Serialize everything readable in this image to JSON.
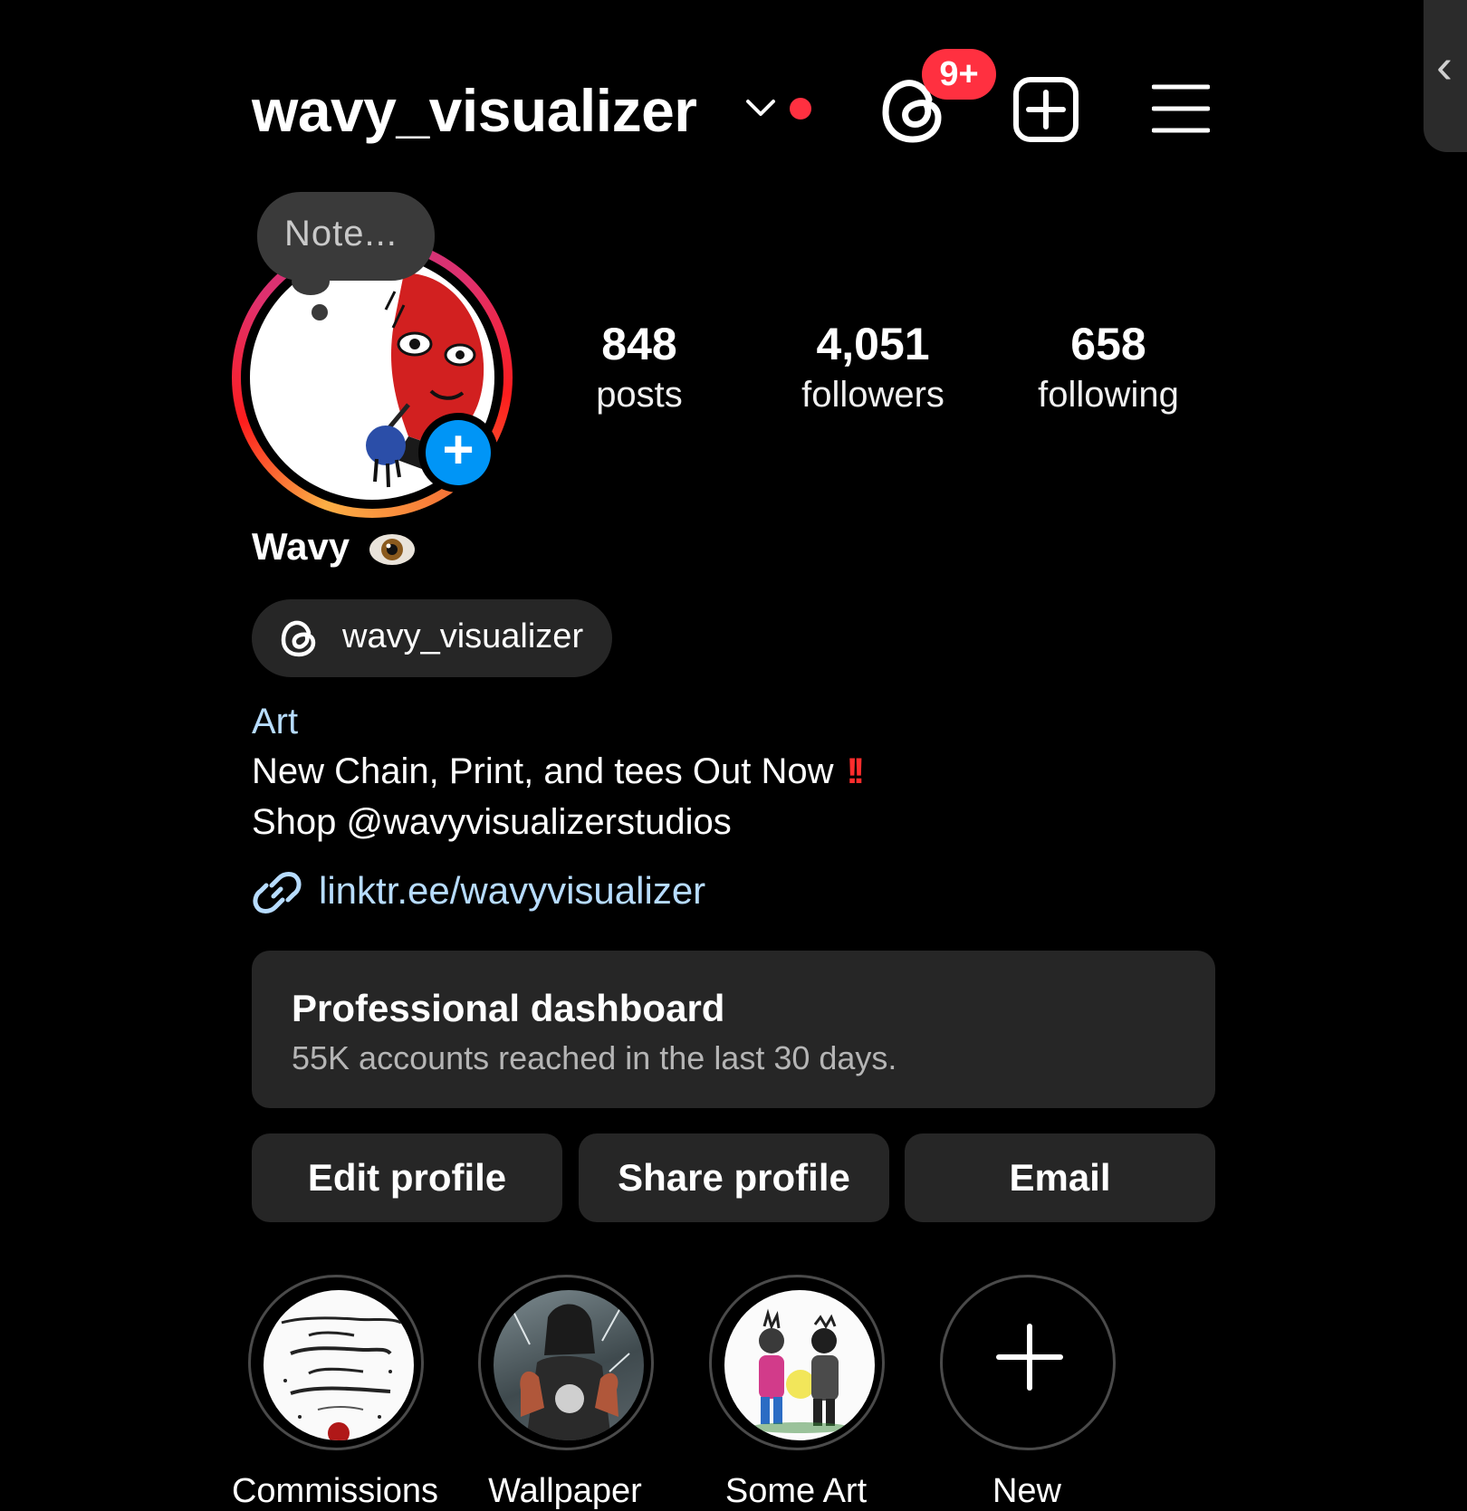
{
  "header": {
    "username": "wavy_visualizer",
    "notification_badge": "9+",
    "accent_color": "#ff3040"
  },
  "note": {
    "placeholder": "Note..."
  },
  "stats": [
    {
      "value": "848",
      "label": "posts"
    },
    {
      "value": "4,051",
      "label": "followers"
    },
    {
      "value": "658",
      "label": "following"
    }
  ],
  "profile": {
    "display_name": "Wavy",
    "threads_handle": "wavy_visualizer",
    "category": "Art",
    "bio_line1": "New Chain, Print, and tees Out Now",
    "bio_line1_emoji": "!!",
    "bio_line2": "Shop @wavyvisualizerstudios",
    "link": "linktr.ee/wavyvisualizer"
  },
  "dashboard": {
    "title": "Professional dashboard",
    "subtitle": "55K accounts reached in the last 30 days."
  },
  "buttons": {
    "edit": "Edit profile",
    "share": "Share profile",
    "email": "Email"
  },
  "highlights": [
    {
      "label": "Commissions"
    },
    {
      "label": "Wallpaper"
    },
    {
      "label": "Some Art"
    },
    {
      "label": "New"
    }
  ],
  "link_color": "#b7dcff",
  "blue_accent": "#0095f6"
}
